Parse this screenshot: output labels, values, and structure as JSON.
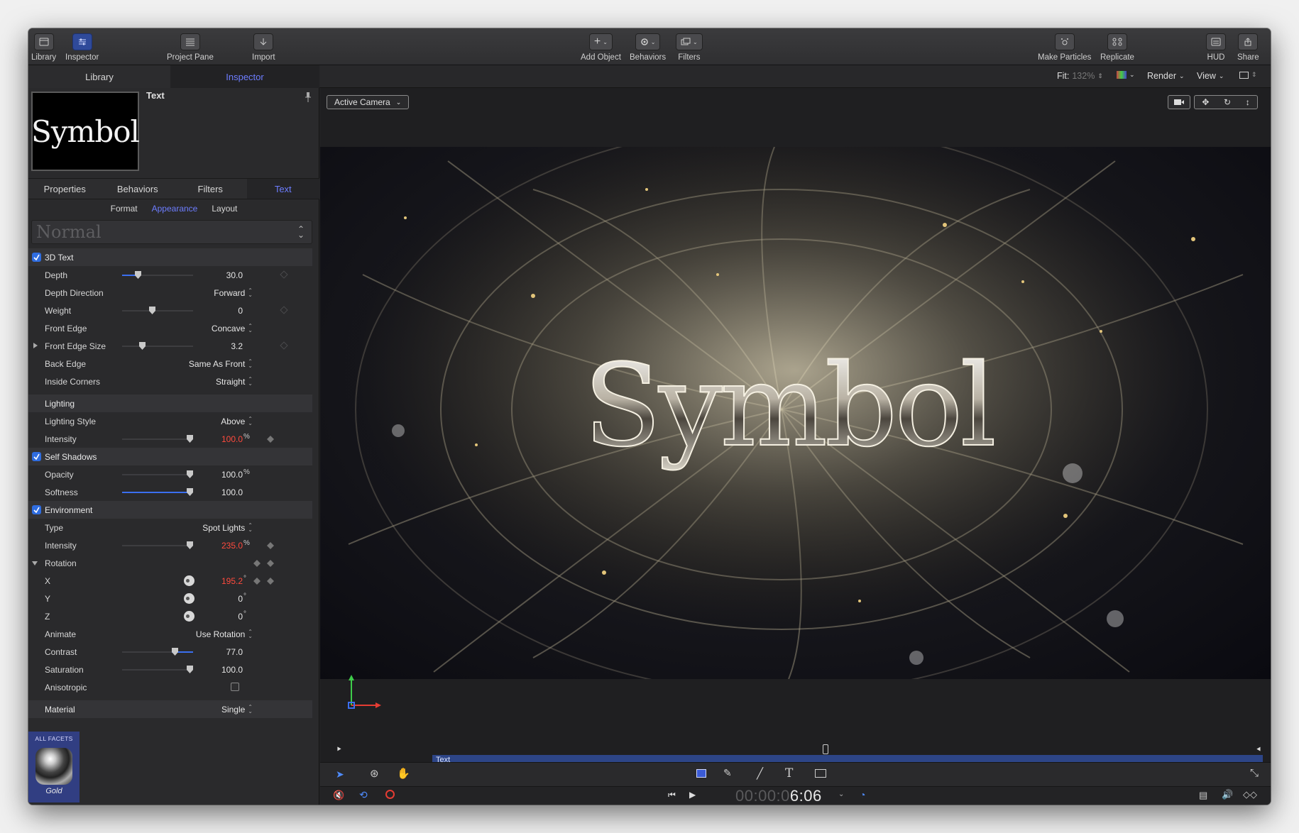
{
  "toolbar": {
    "library": "Library",
    "inspector": "Inspector",
    "project_pane": "Project Pane",
    "import": "Import",
    "add_object": "Add Object",
    "behaviors": "Behaviors",
    "filters": "Filters",
    "make_particles": "Make Particles",
    "replicate": "Replicate",
    "hud": "HUD",
    "share": "Share"
  },
  "panel_tabs": {
    "library": "Library",
    "inspector": "Inspector"
  },
  "viewer_bar": {
    "fit_label": "Fit:",
    "fit_value": "132%",
    "render": "Render",
    "view": "View",
    "camera": "Active Camera"
  },
  "inspector": {
    "preview_text": "Symbol",
    "title": "Text",
    "tabs": [
      "Properties",
      "Behaviors",
      "Filters",
      "Text"
    ],
    "subtabs": [
      "Format",
      "Appearance",
      "Layout"
    ],
    "preset": "Normal",
    "rows": {
      "text3d": "3D Text",
      "depth": "Depth",
      "depth_val": "30.0",
      "depth_dir": "Depth Direction",
      "depth_dir_val": "Forward",
      "weight": "Weight",
      "weight_val": "0",
      "front_edge": "Front Edge",
      "front_edge_val": "Concave",
      "front_edge_size": "Front Edge Size",
      "front_edge_size_val": "3.2",
      "back_edge": "Back Edge",
      "back_edge_val": "Same As Front",
      "inside_corners": "Inside Corners",
      "inside_corners_val": "Straight",
      "lighting": "Lighting",
      "lighting_style": "Lighting Style",
      "lighting_style_val": "Above",
      "intensity": "Intensity",
      "intensity_val": "100.0",
      "self_shadows": "Self Shadows",
      "opacity": "Opacity",
      "opacity_val": "100.0",
      "softness": "Softness",
      "softness_val": "100.0",
      "environment": "Environment",
      "type": "Type",
      "type_val": "Spot Lights",
      "env_intensity": "Intensity",
      "env_intensity_val": "235.0",
      "rotation": "Rotation",
      "x": "X",
      "x_val": "195.2",
      "y": "Y",
      "y_val": "0",
      "z": "Z",
      "z_val": "0",
      "animate": "Animate",
      "animate_val": "Use Rotation",
      "contrast": "Contrast",
      "contrast_val": "77.0",
      "saturation": "Saturation",
      "saturation_val": "100.0",
      "anisotropic": "Anisotropic",
      "material": "Material",
      "material_val": "Single",
      "percent": "%",
      "degree": "°"
    },
    "facet": {
      "header": "ALL FACETS",
      "name": "Gold"
    }
  },
  "viewer": {
    "title_text": "Symbol"
  },
  "timeline": {
    "track_label": "Text"
  },
  "timecode": {
    "dim": "00:00:0",
    "bright": "6:06"
  },
  "colors": {
    "accent": "#3b6ff0",
    "keyed_red": "#ff4a3d",
    "active_tab": "#6d7dff"
  }
}
